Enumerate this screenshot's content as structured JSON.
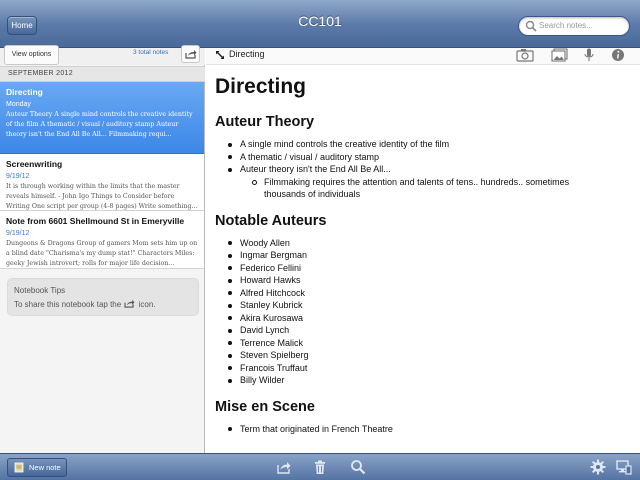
{
  "header": {
    "home_label": "Home",
    "title": "CC101",
    "search_placeholder": "Search notes..."
  },
  "sidebar": {
    "view_options_label": "View options",
    "total_notes": "3 total notes",
    "section_label": "SEPTEMBER 2012",
    "notes": [
      {
        "title": "Directing",
        "date": "Monday",
        "snippet": " Auteur Theory A single mind controls the creative identity of the film A thematic / visual / auditory stamp Auteur theory isn't the End All Be All... Filmmaking requi..."
      },
      {
        "title": "Screenwriting",
        "date": "9/19/12",
        "snippet": "It is through working within the limits that the master reveals himself. - John Igo Things to Consider before Writing One script per group (4-8 pages) Write something..."
      },
      {
        "title": "Note from 6601 Shellmound St in Emeryville",
        "date": "9/19/12",
        "snippet": "Dungeons & Dragons Group of gamers Mom sets him up on a blind date \"Charisma's my dump stat!\" Characters Miles: geeky Jewish introvert; rolls for major life decision..."
      }
    ],
    "tips": {
      "title": "Notebook Tips",
      "text_before": "To share this notebook tap the",
      "text_after": "icon."
    }
  },
  "editor": {
    "note_title": "Directing",
    "heading": "Directing",
    "sections": {
      "auteur": {
        "title": "Auteur Theory",
        "items": [
          "A single mind controls the creative identity of the film",
          "A thematic / visual / auditory stamp",
          "Auteur theory isn't the End All Be All..."
        ],
        "sub_item": "Filmmaking requires the attention and talents of tens.. hundreds.. sometimes thousands of individuals"
      },
      "notable": {
        "title": "Notable Auteurs",
        "items": [
          "Woody Allen",
          "Ingmar Bergman",
          "Federico Fellini",
          "Howard Hawks",
          "Alfred Hitchcock",
          "Stanley Kubrick",
          "Akira Kurosawa",
          "David Lynch",
          "Terrence Malick",
          "Steven Spielberg",
          "Francois Truffaut",
          "Billy Wilder"
        ]
      },
      "mise": {
        "title": "Mise en Scene",
        "items": [
          "Term that originated in French Theatre"
        ]
      }
    }
  },
  "footer": {
    "new_note_label": "New note"
  },
  "icons": {
    "search": "search-icon",
    "share": "share-icon",
    "expand": "expand-icon",
    "camera": "camera-icon",
    "photos": "photo-library-icon",
    "microphone": "microphone-icon",
    "info": "info-icon",
    "trash": "trash-icon",
    "gear": "gear-icon",
    "sync": "sync-icon"
  },
  "colors": {
    "header_blue": "#5a79a8",
    "selected_blue": "#3d87e8",
    "date_blue": "#3d7cc9"
  }
}
